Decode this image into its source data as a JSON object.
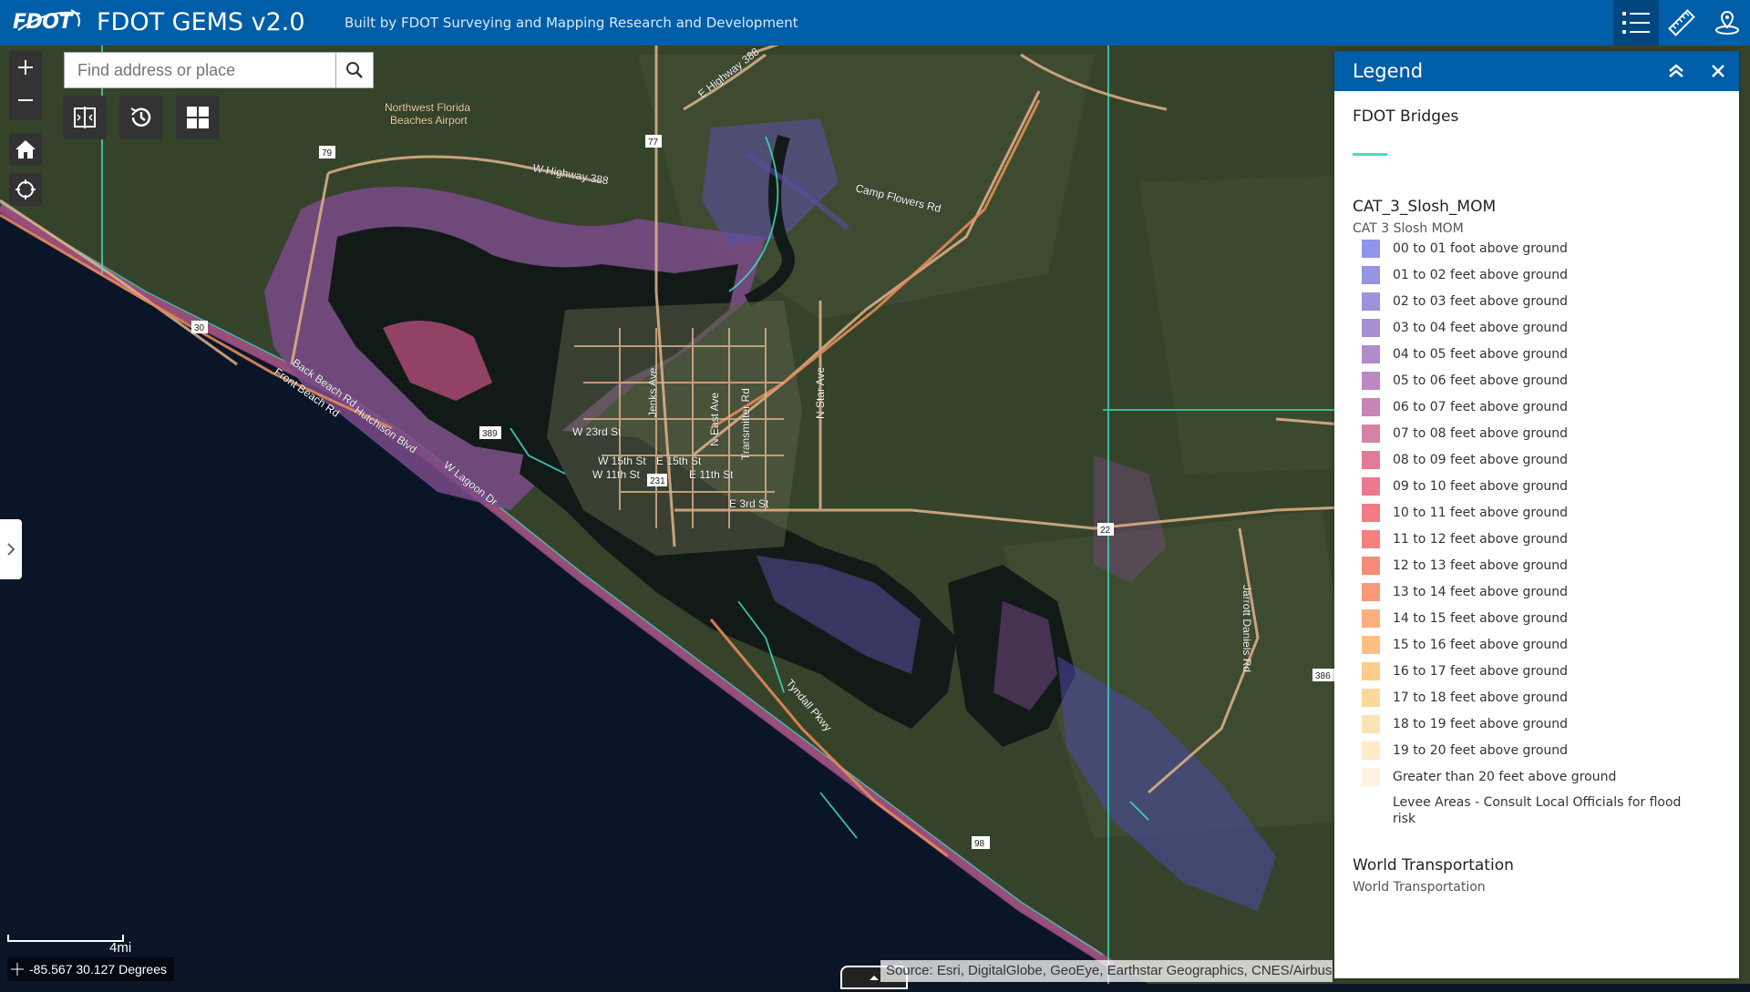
{
  "header": {
    "logo_text": "FDOT",
    "title": "FDOT GEMS v2.0",
    "subtitle": "Built by FDOT Surveying and Mapping Research and Development",
    "buttons": [
      "legend-list-icon",
      "measure-ruler-icon",
      "location-pin-icon"
    ]
  },
  "search": {
    "placeholder": "Find address or place"
  },
  "map": {
    "labels": {
      "airport": "Northwest Florida Beaches Airport",
      "hwy388_west": "W Highway 388",
      "hwy388_north": "E Highway 388",
      "camp_flowers": "Camp Flowers Rd",
      "back_beach": "Back Beach Rd",
      "front_beach": "Front Beach Rd",
      "hutchison": "Hutchison Blvd",
      "lagoon": "W Lagoon Dr",
      "w23rd": "W 23rd St",
      "w15th": "W 15th St",
      "e15th": "E 15th St",
      "w11th": "W 11th St",
      "e11th": "E 11th St",
      "e3rd": "E 3rd St",
      "jenks": "Jenks Ave",
      "east_ave": "N East Ave",
      "transmitter": "Transmitter Rd",
      "star_ave": "N Star Ave",
      "tyndall": "Tyndall Pkwy",
      "jarrott": "Jarrott Daniels Rd",
      "shield_79": "79",
      "shield_77": "77",
      "shield_30": "30",
      "shield_231": "231",
      "shield_22": "22",
      "shield_98": "98",
      "shield_386": "386",
      "shield_389": "389"
    },
    "scale_label": "4mi",
    "coordinates": "-85.567 30.127 Degrees",
    "attribution": "Source: Esri, DigitalGlobe, GeoEye, Earthstar Geographics, CNES/Airbus DS, USDA, USGS"
  },
  "legend": {
    "title": "Legend",
    "bridges": {
      "name": "FDOT Bridges",
      "color": "#3ee0c6"
    },
    "surge": {
      "name": "CAT_3_Slosh_MOM",
      "sublabel": "CAT 3 Slosh MOM",
      "items": [
        {
          "label": "00 to 01 foot above ground",
          "color": "#8f95e8"
        },
        {
          "label": "01 to 02 feet above ground",
          "color": "#9595e2"
        },
        {
          "label": "02 to 03 feet above ground",
          "color": "#9c93dc"
        },
        {
          "label": "03 to 04 feet above ground",
          "color": "#a690d3"
        },
        {
          "label": "04 to 05 feet above ground",
          "color": "#b08ccb"
        },
        {
          "label": "05 to 06 feet above ground",
          "color": "#bb88c2"
        },
        {
          "label": "06 to 07 feet above ground",
          "color": "#c885b4"
        },
        {
          "label": "07 to 08 feet above ground",
          "color": "#d681a6"
        },
        {
          "label": "08 to 09 feet above ground",
          "color": "#e07c9a"
        },
        {
          "label": "09 to 10 feet above ground",
          "color": "#ea7990"
        },
        {
          "label": "10 to 11 feet above ground",
          "color": "#f27b86"
        },
        {
          "label": "11 to 12 feet above ground",
          "color": "#f5807e"
        },
        {
          "label": "12 to 13 feet above ground",
          "color": "#f78b7a"
        },
        {
          "label": "13 to 14 feet above ground",
          "color": "#f89a7a"
        },
        {
          "label": "14 to 15 feet above ground",
          "color": "#fab07e"
        },
        {
          "label": "15 to 16 feet above ground",
          "color": "#fbc084"
        },
        {
          "label": "16 to 17 feet above ground",
          "color": "#fccd8c"
        },
        {
          "label": "17 to 18 feet above ground",
          "color": "#fdd89c"
        },
        {
          "label": "18 to 19 feet above ground",
          "color": "#fde3b4"
        },
        {
          "label": "19 to 20 feet above ground",
          "color": "#feebc8"
        },
        {
          "label": "Greater than 20 feet above ground",
          "color": "#fef3e0"
        },
        {
          "label": "Levee Areas - Consult Local Officials for flood risk",
          "color": "#ffffff"
        }
      ]
    },
    "transportation": {
      "name": "World Transportation",
      "sublabel": "World Transportation"
    }
  }
}
